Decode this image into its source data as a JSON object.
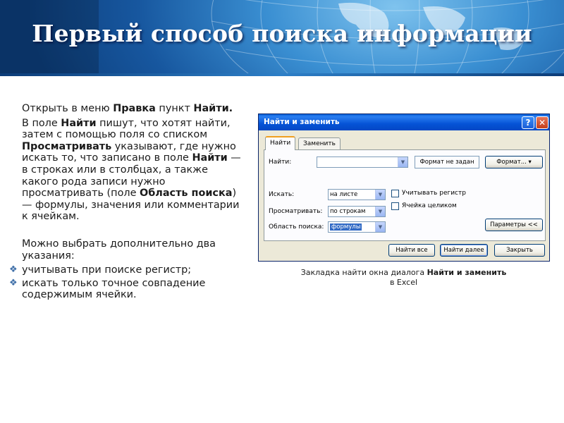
{
  "slide": {
    "title": "Первый способ поиска информации"
  },
  "text": {
    "p1_a": "Открыть в меню ",
    "p1_b": "Правка",
    "p1_c": "  пункт ",
    "p1_d": "Найти.",
    "p2_a": "В поле ",
    "p2_b": "Найти",
    "p2_c": " пишут, что хотят найти, затем с помощью поля со списком ",
    "p2_d": "Просматривать",
    "p2_e": " указывают, где нужно искать то, что записано в поле ",
    "p2_f": "Найти",
    "p2_g": " — в строках или в столбцах, а также какого рода записи нужно просматривать (поле ",
    "p2_h": "Область поиска",
    "p2_i": ") — формулы, значения или комментарии к ячейкам.",
    "p3": "Можно выбрать дополнительно два указания:",
    "bullets": [
      " учитывать при поиске регистр;",
      " искать только точное совпадение содержимым ячейки."
    ]
  },
  "dialog": {
    "title": "Найти и заменить",
    "tabs": [
      "Найти",
      "Заменить"
    ],
    "find_label": "Найти:",
    "find_value": "",
    "format_status_button": "Формат не задан",
    "format_button": "Формат...",
    "within_label": "Искать:",
    "within_value": "на листе",
    "search_label": "Просматривать:",
    "search_value": "по строкам",
    "lookin_label": "Область поиска:",
    "lookin_value": "формулы",
    "match_case_label": "Учитывать регистр",
    "match_case_checked": false,
    "match_entire_label": "Ячейка целиком",
    "match_entire_checked": false,
    "options_button": "Параметры <<",
    "find_all_button": "Найти все",
    "find_next_button": "Найти далее",
    "close_button": "Закрыть",
    "help_symbol": "?",
    "close_symbol": "✕"
  },
  "caption": {
    "a": "Закладка найти окна диалога ",
    "b": "Найти и заменить",
    "c": " в Excel"
  },
  "icons": {
    "bullet": "diamond-bullet-icon",
    "dropdown": "chevron-down-icon"
  },
  "colors": {
    "title_bar": "#0553d6",
    "banner_dark": "#0d3f7d",
    "bullet": "#3f6fa8"
  }
}
